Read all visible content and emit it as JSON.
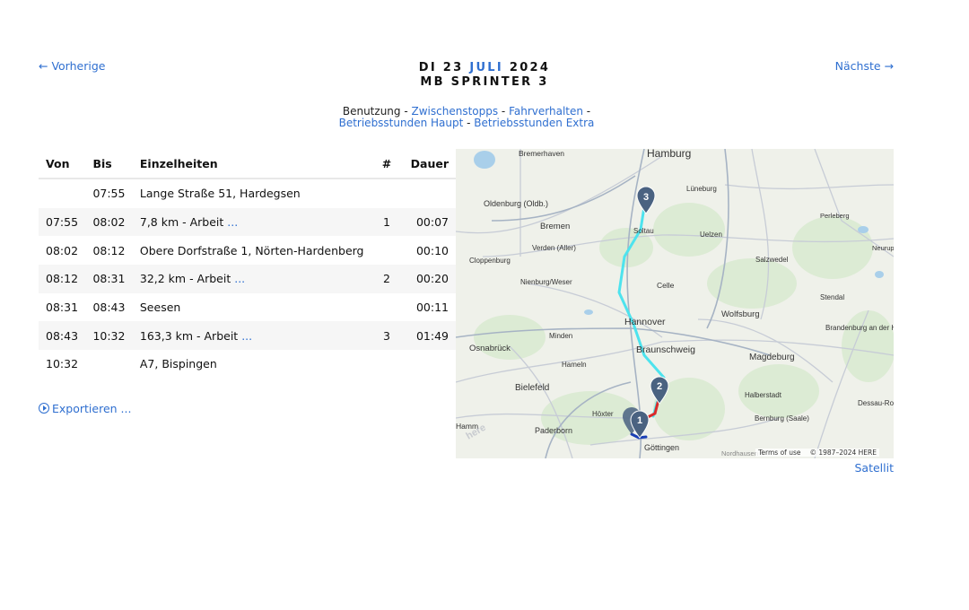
{
  "nav": {
    "prev": "← Vorherige",
    "next": "Nächste →"
  },
  "header": {
    "weekday_day": "DI 23",
    "month": "JULI",
    "year": "2024",
    "vehicle": "MB SPRINTER 3"
  },
  "subnav": {
    "current": "Benutzung",
    "sep": " - ",
    "links": [
      "Zwischenstopps",
      "Fahrverhalten",
      "Betriebsstunden Haupt",
      "Betriebsstunden Extra"
    ]
  },
  "table": {
    "headers": {
      "from": "Von",
      "to": "Bis",
      "details": "Einzelheiten",
      "num": "#",
      "duration": "Dauer"
    },
    "rows": [
      {
        "from": "",
        "to": "07:55",
        "details": "Lange Straße 51, Hardegsen",
        "more": "",
        "num": "",
        "duration": ""
      },
      {
        "from": "07:55",
        "to": "08:02",
        "details": "7,8 km - Arbeit",
        "more": "...",
        "num": "1",
        "duration": "00:07"
      },
      {
        "from": "08:02",
        "to": "08:12",
        "details": "Obere Dorfstraße 1, Nörten-Hardenberg",
        "more": "",
        "num": "",
        "duration": "00:10"
      },
      {
        "from": "08:12",
        "to": "08:31",
        "details": "32,2 km - Arbeit",
        "more": "...",
        "num": "2",
        "duration": "00:20"
      },
      {
        "from": "08:31",
        "to": "08:43",
        "details": "Seesen",
        "more": "",
        "num": "",
        "duration": "00:11"
      },
      {
        "from": "08:43",
        "to": "10:32",
        "details": "163,3 km - Arbeit",
        "more": "...",
        "num": "3",
        "duration": "01:49"
      },
      {
        "from": "10:32",
        "to": "",
        "details": "A7, Bispingen",
        "more": "",
        "num": "",
        "duration": ""
      }
    ]
  },
  "export": {
    "label": "Exportieren ..."
  },
  "map": {
    "cities": [
      "Hamburg",
      "Bremerhaven",
      "Lüneburg",
      "Oldenburg (Oldb.)",
      "Bremen",
      "Soltau",
      "Uelzen",
      "Perleberg",
      "Verden (Aller)",
      "Cloppenburg",
      "Salzwedel",
      "Nienburg/Weser",
      "Celle",
      "Stendal",
      "Hannover",
      "Wolfsburg",
      "Osnabrück",
      "Minden",
      "Braunschweig",
      "Magdeburg",
      "Brandenburg an der Havel",
      "Hameln",
      "Bielefeld",
      "Halberstadt",
      "Höxter",
      "Bernburg (Saale)",
      "Paderborn",
      "Göttingen",
      "Nordhausen",
      "Dessau-Roßlau",
      "Neuruppin",
      "Hamm"
    ],
    "markers": [
      "1",
      "2",
      "3"
    ],
    "logo": "here",
    "terms": "Terms of use",
    "copyright": "© 1987–2024 HERE",
    "route_colors": {
      "segment1": "#1a3fb5",
      "segment2": "#d92b2b",
      "segment3": "#4de3ee",
      "marker": "#4a6281"
    }
  },
  "satellite": "Satellit"
}
